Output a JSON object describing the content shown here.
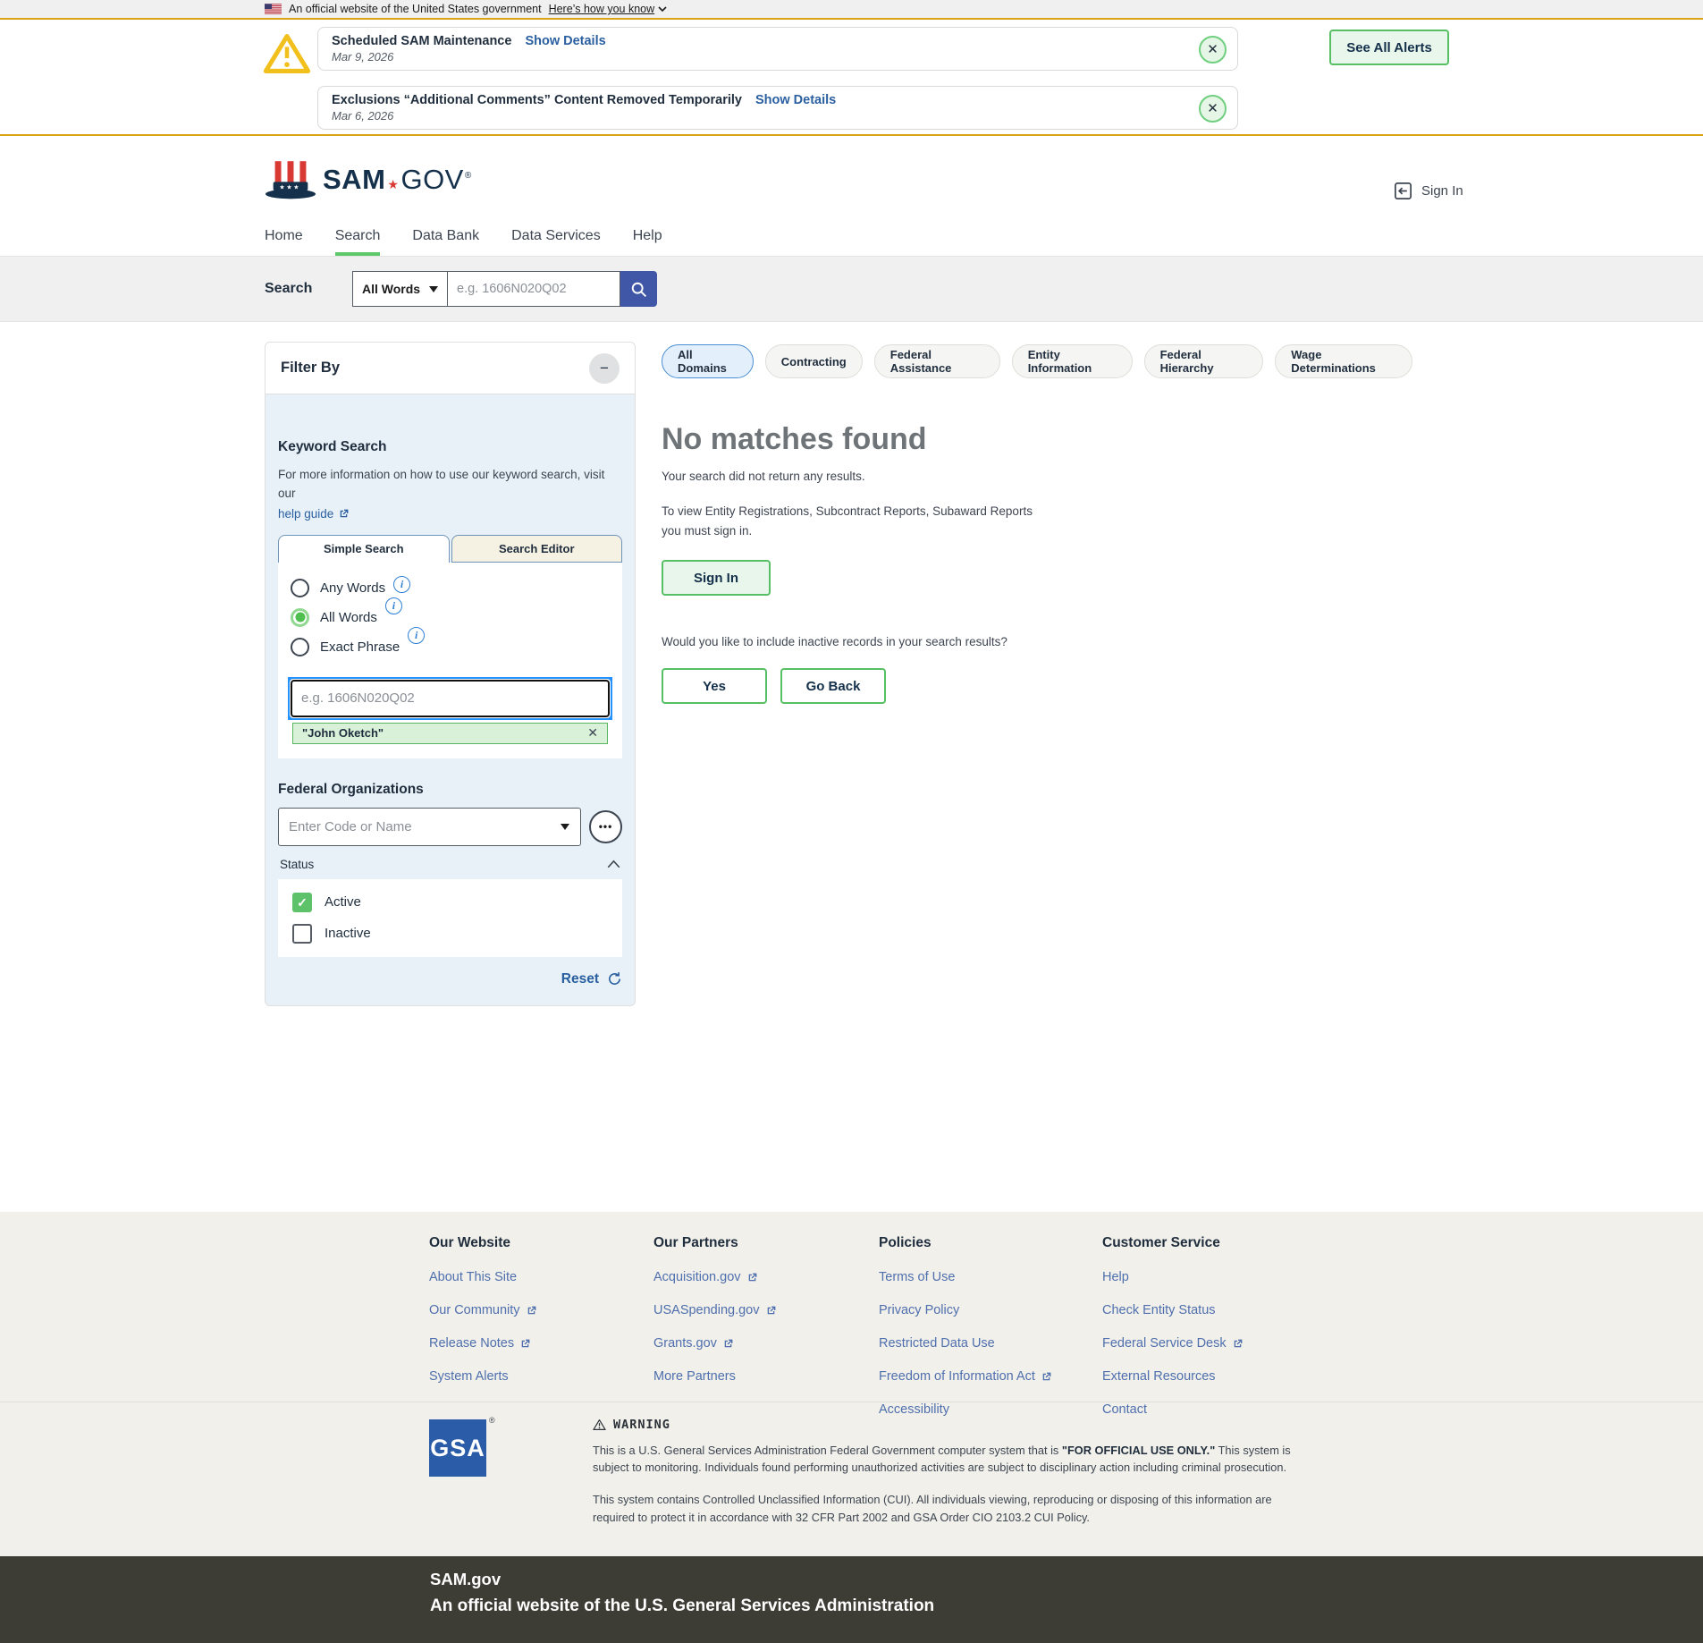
{
  "colors": {
    "accent_green": "#57c065",
    "light_green_bg": "#e9f6ec",
    "navy_text": "#1f2d3d",
    "link_blue": "#2a5fa0",
    "footer_link_blue": "#4f6fae",
    "gold_rule": "#d9a514",
    "search_button_indigo": "#3f57a6",
    "active_nav_green": "#5dc96b",
    "filter_panel_blue": "#e8f1f8",
    "gsa_blue": "#2a5ca8",
    "dark_footer_bg": "#3d3c35",
    "focus_ring_blue": "#2491ff"
  },
  "icons": {
    "us_flag": "us-flag",
    "chevron_down": "v",
    "warning_triangle": "!",
    "close": "×",
    "collapse_minus": "−",
    "search_magnifier": "magnifier",
    "info": "i",
    "external_link": "box-arrow",
    "dropdown_caret": "▼",
    "ellipsis": "•••",
    "chevron_up": "^",
    "reset_refresh": "↻",
    "sign_in_arrow": "←",
    "logo_star": "★",
    "check": "✓",
    "registered": "®"
  },
  "gov_banner": {
    "text": "An official website of the United States government",
    "link": "Here’s how you know"
  },
  "alerts": {
    "see_all": "See All Alerts",
    "items": [
      {
        "title": "Scheduled SAM Maintenance",
        "details_link": "Show Details",
        "date": "Mar 9, 2026"
      },
      {
        "title": "Exclusions “Additional Comments” Content Removed Temporarily",
        "details_link": "Show Details",
        "date": "Mar 6, 2026"
      }
    ]
  },
  "header": {
    "logo": {
      "sam": "SAM",
      "gov": "GOV",
      "registered": "®"
    },
    "sign_in": "Sign In",
    "nav": [
      {
        "label": "Home"
      },
      {
        "label": "Search"
      },
      {
        "label": "Data Bank"
      },
      {
        "label": "Data Services"
      },
      {
        "label": "Help"
      }
    ],
    "active_nav": "Search"
  },
  "search_bar": {
    "label": "Search",
    "mode_selected": "All Words",
    "placeholder": "e.g. 1606N020Q02"
  },
  "filter": {
    "title": "Filter By",
    "keyword": {
      "heading": "Keyword Search",
      "info_text": "For more information on how to use our keyword search, visit our",
      "help_link": "help guide",
      "tabs": [
        {
          "label": "Simple Search",
          "active": true
        },
        {
          "label": "Search Editor",
          "active": false
        }
      ],
      "radios": [
        {
          "label": "Any Words",
          "selected": false
        },
        {
          "label": "All Words",
          "selected": true
        },
        {
          "label": "Exact Phrase",
          "selected": false
        }
      ],
      "input_placeholder": "e.g. 1606N020Q02",
      "chip": "\"John Oketch\""
    },
    "federal_organizations": {
      "heading": "Federal Organizations",
      "placeholder": "Enter Code or Name"
    },
    "status": {
      "label": "Status",
      "options": [
        {
          "label": "Active",
          "checked": true
        },
        {
          "label": "Inactive",
          "checked": false
        }
      ]
    },
    "reset_label": "Reset"
  },
  "results": {
    "domains": [
      {
        "label": "All Domains",
        "active": true
      },
      {
        "label": "Contracting",
        "active": false
      },
      {
        "label": "Federal Assistance",
        "active": false
      },
      {
        "label": "Entity Information",
        "active": false
      },
      {
        "label": "Federal Hierarchy",
        "active": false
      },
      {
        "label": "Wage Determinations",
        "active": false
      }
    ],
    "title": "No matches found",
    "subtitle": "Your search did not return any results.",
    "signin_note": "To view Entity Registrations, Subcontract Reports, Subaward Reports you must sign in.",
    "signin_button": "Sign In",
    "inactive_question": "Would you like to include inactive records in your search results?",
    "yes_button": "Yes",
    "go_back_button": "Go Back"
  },
  "footer": {
    "columns": [
      {
        "heading": "Our Website",
        "links": [
          {
            "label": "About This Site",
            "external": false
          },
          {
            "label": "Our Community",
            "external": true
          },
          {
            "label": "Release Notes",
            "external": true
          },
          {
            "label": "System Alerts",
            "external": false
          }
        ]
      },
      {
        "heading": "Our Partners",
        "links": [
          {
            "label": "Acquisition.gov",
            "external": true
          },
          {
            "label": "USASpending.gov",
            "external": true
          },
          {
            "label": "Grants.gov",
            "external": true
          },
          {
            "label": "More Partners",
            "external": false
          }
        ]
      },
      {
        "heading": "Policies",
        "links": [
          {
            "label": "Terms of Use",
            "external": false
          },
          {
            "label": "Privacy Policy",
            "external": false
          },
          {
            "label": "Restricted Data Use",
            "external": false
          },
          {
            "label": "Freedom of Information Act",
            "external": true
          },
          {
            "label": "Accessibility",
            "external": false
          }
        ]
      },
      {
        "heading": "Customer Service",
        "links": [
          {
            "label": "Help",
            "external": false
          },
          {
            "label": "Check Entity Status",
            "external": false
          },
          {
            "label": "Federal Service Desk",
            "external": true
          },
          {
            "label": "External Resources",
            "external": false
          },
          {
            "label": "Contact",
            "external": false
          }
        ]
      }
    ],
    "gsa_logo": "GSA",
    "gsa_registered": "®",
    "warning": {
      "title": "WARNING",
      "p1a": "This is a U.S. General Services Administration Federal Government computer system that is ",
      "p1_bold": "\"FOR OFFICIAL USE ONLY.\"",
      "p1b": " This system is subject to monitoring. Individuals found performing unauthorized activities are subject to disciplinary action including criminal prosecution.",
      "p2": "This system contains Controlled Unclassified Information (CUI). All individuals viewing, reproducing or disposing of this information are required to protect it in accordance with 32 CFR Part 2002 and GSA Order CIO 2103.2 CUI Policy."
    },
    "dark": {
      "site": "SAM.gov",
      "official_line": "An official website of the U.S. General Services Administration"
    }
  }
}
